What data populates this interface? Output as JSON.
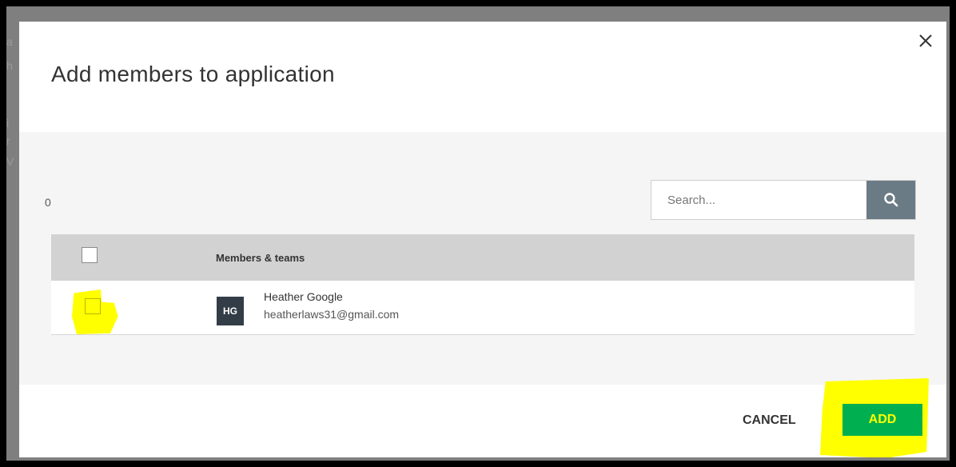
{
  "background": {
    "peek_lines": [
      "a",
      "h",
      "i",
      "r",
      "V"
    ]
  },
  "dialog": {
    "title": "Add members to application",
    "close_icon": "close-icon"
  },
  "list": {
    "count": "0",
    "search": {
      "placeholder": "Search...",
      "icon": "search-icon"
    },
    "header": {
      "label": "Members & teams"
    },
    "rows": [
      {
        "avatar": "HG",
        "name": "Heather Google",
        "email": "heatherlaws31@gmail.com",
        "checked": false
      }
    ]
  },
  "footer": {
    "cancel_label": "CANCEL",
    "add_label": "ADD"
  },
  "colors": {
    "add_button": "#00b050",
    "highlight": "#ffff00",
    "search_button": "#6b7b85",
    "header_row": "#d2d2d2"
  }
}
